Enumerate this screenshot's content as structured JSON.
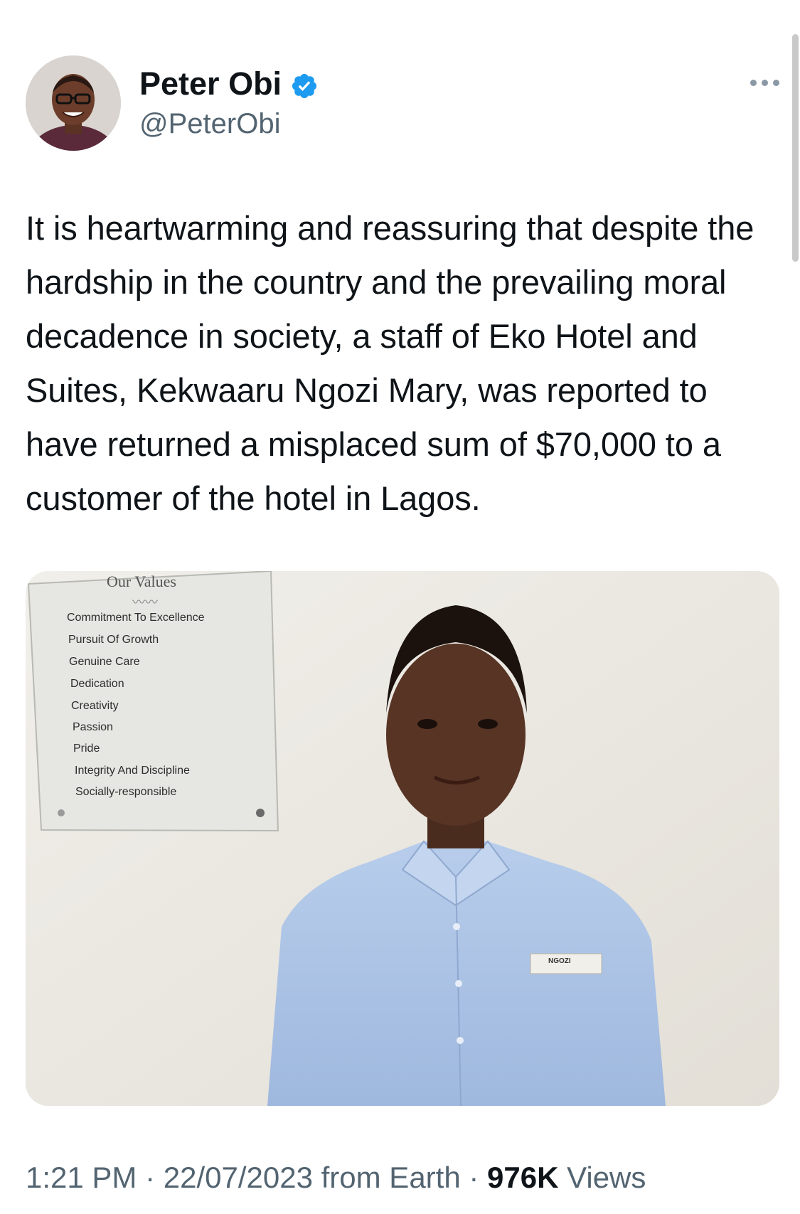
{
  "author": {
    "display_name": "Peter Obi",
    "handle": "@PeterObi",
    "verified_badge_icon": "verified-badge-icon",
    "avatar": "avatar-photo"
  },
  "menu_icon": "more-options-icon",
  "tweet": {
    "text": "It is heartwarming and reassuring that despite the hardship in the country and the prevailing moral decadence in society, a staff of Eko Hotel and Suites, Kekwaaru Ngozi Mary, was reported to have returned a misplaced sum of $70,000 to a customer of the hotel in Lagos."
  },
  "media": {
    "plaque_title": "Our Values",
    "plaque_items": [
      "Commitment To Excellence",
      "Pursuit Of Growth",
      "Genuine Care",
      "Dedication",
      "Creativity",
      "Passion",
      "Pride",
      "Integrity And Discipline",
      "Socially-responsible"
    ],
    "name_tag": "NGOZI"
  },
  "meta": {
    "time": "1:21 PM",
    "sep1": " · ",
    "date": "22/07/2023",
    "source": " from Earth",
    "sep2": " · ",
    "views_count": "976K",
    "views_label": " Views"
  },
  "colors": {
    "accent": "#1d9bf0",
    "secondary_text": "#536471",
    "primary_text": "#0f1419"
  }
}
